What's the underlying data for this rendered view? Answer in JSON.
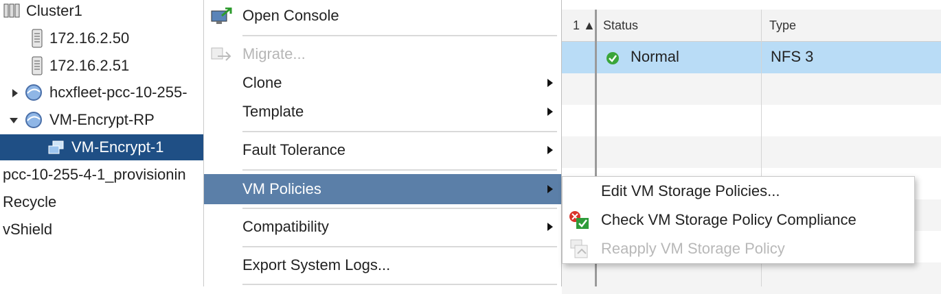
{
  "tree": {
    "items": [
      {
        "label": "Cluster1",
        "icon": "cluster-icon"
      },
      {
        "label": "172.16.2.50",
        "icon": "host-icon"
      },
      {
        "label": "172.16.2.51",
        "icon": "host-icon"
      },
      {
        "label": "hcxfleet-pcc-10-255-",
        "icon": "resource-pool-icon"
      },
      {
        "label": "VM-Encrypt-RP",
        "icon": "resource-pool-icon"
      },
      {
        "label": "VM-Encrypt-1",
        "icon": "vm-icon"
      },
      {
        "label": "pcc-10-255-4-1_provisionin"
      },
      {
        "label": "Recycle"
      },
      {
        "label": "vShield"
      }
    ]
  },
  "grid": {
    "sort_indicator": "1 ▲",
    "columns": [
      "Status",
      "Type"
    ],
    "rows": [
      {
        "status": "Normal",
        "type": "NFS 3"
      }
    ],
    "status_color": "#3aa53a",
    "selected_row_color": "#b9dcf6"
  },
  "context_menu": {
    "items": [
      {
        "label": "Open Console",
        "icon": "console-icon"
      },
      {
        "label": "Migrate...",
        "icon": "migrate-icon",
        "disabled": true
      },
      {
        "label": "Clone",
        "submenu": true
      },
      {
        "label": "Template",
        "submenu": true
      },
      {
        "label": "Fault Tolerance",
        "submenu": true
      },
      {
        "label": "VM Policies",
        "submenu": true,
        "highlighted": true
      },
      {
        "label": "Compatibility",
        "submenu": true
      },
      {
        "label": "Export System Logs..."
      }
    ],
    "highlight_color": "#5b7fa8"
  },
  "submenu": {
    "items": [
      {
        "label": "Edit VM Storage Policies..."
      },
      {
        "label": "Check VM Storage Policy Compliance",
        "icon": "compliance-check-icon"
      },
      {
        "label": "Reapply VM Storage Policy",
        "icon": "reapply-policy-icon",
        "disabled": true
      }
    ]
  }
}
